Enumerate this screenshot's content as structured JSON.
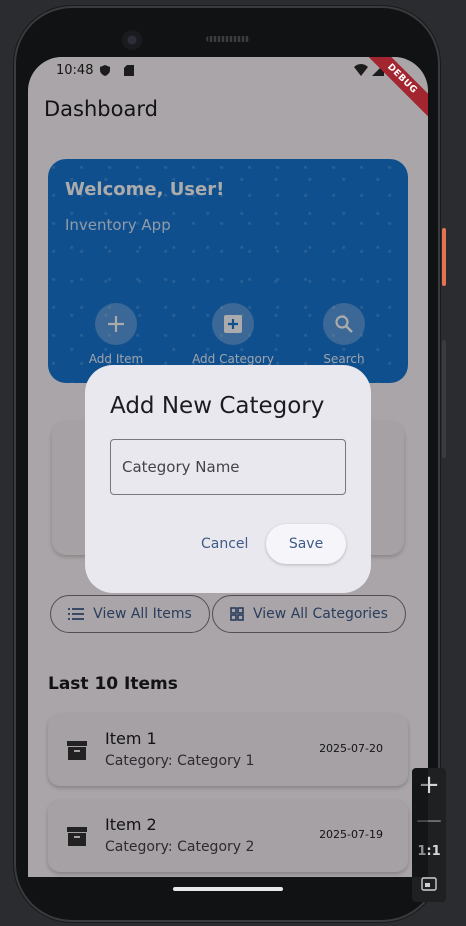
{
  "status_bar": {
    "time": "10:48"
  },
  "debug_banner": "DEBUG",
  "app_bar": {
    "title": "Dashboard"
  },
  "welcome_card": {
    "title": "Welcome, User!",
    "subtitle": "Inventory App",
    "actions": [
      {
        "label": "Add Item",
        "icon": "plus-icon"
      },
      {
        "label": "Add Category",
        "icon": "add-box-icon"
      },
      {
        "label": "Search",
        "icon": "search-icon"
      }
    ]
  },
  "buttons": {
    "view_all_items": "View All Items",
    "view_all_categories": "View All Categories"
  },
  "recent": {
    "title": "Last 10 Items",
    "items": [
      {
        "name": "Item 1",
        "category": "Category: Category 1",
        "date": "2025-07-20"
      },
      {
        "name": "Item 2",
        "category": "Category: Category 2",
        "date": "2025-07-19"
      }
    ]
  },
  "dialog": {
    "title": "Add New Category",
    "input_placeholder": "Category Name",
    "input_value": "",
    "cancel_label": "Cancel",
    "save_label": "Save"
  },
  "emulator_toolbar": {
    "zoom_label": "1:1"
  },
  "colors": {
    "primary": "#1877d4",
    "button_text": "#3f5b8a",
    "debug": "#a3252f"
  }
}
